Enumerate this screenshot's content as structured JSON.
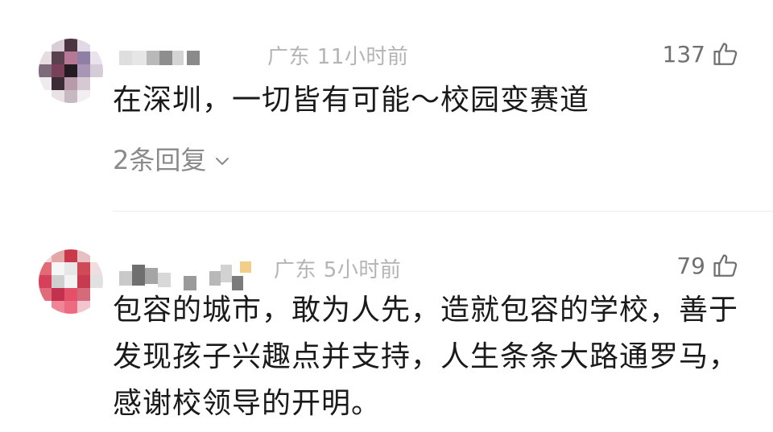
{
  "comments": [
    {
      "location": "广东",
      "time": "11小时前",
      "likes": "137",
      "text_lines": [
        "在深圳，一切皆有可能～校园变赛道"
      ],
      "replies_label": "2条回复",
      "avatar_icon": "blurred-avatar",
      "like_icon": "thumbs-up-icon",
      "chevron_icon": "chevron-down-icon"
    },
    {
      "location": "广东",
      "time": "5小时前",
      "likes": "79",
      "text_lines": [
        "包容的城市，敢为人先，造就包容的学校，善于",
        "发现孩子兴趣点并支持，人生条条大路通罗马，",
        "感谢校领导的开明。"
      ],
      "avatar_icon": "blurred-avatar",
      "like_icon": "thumbs-up-icon"
    }
  ],
  "colors": {
    "meta_text": "#b4b4b4",
    "body_text": "#1a1a1a",
    "reply_text": "#8a8a8a",
    "like_text": "#707070",
    "divider": "#ececec"
  }
}
